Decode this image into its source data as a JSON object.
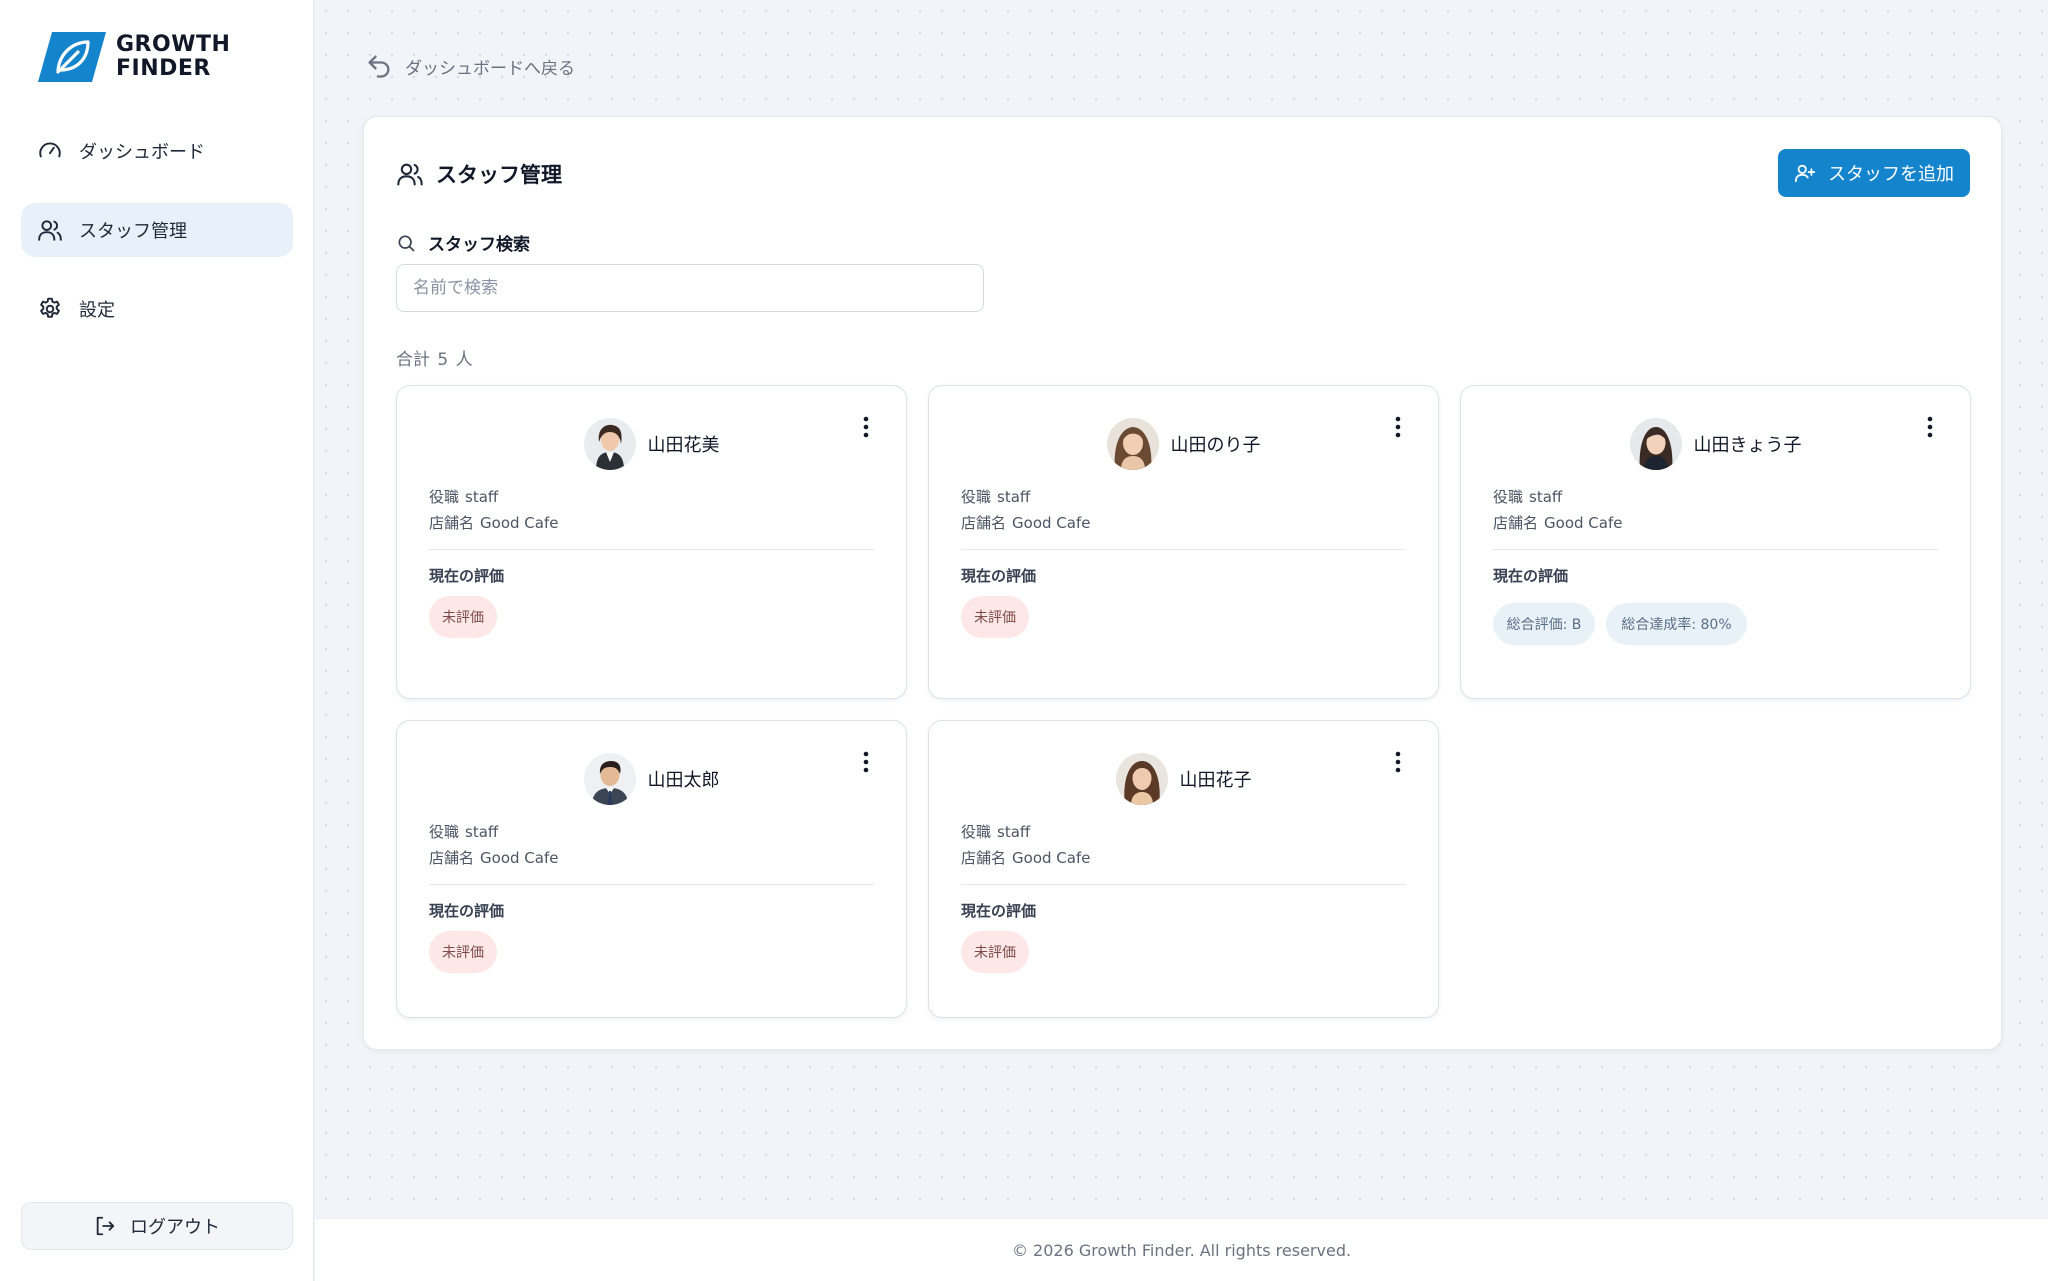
{
  "brand": {
    "line1": "GROWTH",
    "line2": "FINDER",
    "accent": "#1484cc"
  },
  "sidebar": {
    "items": [
      {
        "label": "ダッシュボード",
        "icon": "gauge-icon",
        "active": false
      },
      {
        "label": "スタッフ管理",
        "icon": "users-icon",
        "active": true
      },
      {
        "label": "設定",
        "icon": "gear-icon",
        "active": false
      }
    ],
    "logout": "ログアウト"
  },
  "main": {
    "back_label": "ダッシュボードへ戻る",
    "title": "スタッフ管理",
    "add_button": "スタッフを追加",
    "search_label": "スタッフ検索",
    "search_placeholder": "名前で検索",
    "total": {
      "prefix": "合計",
      "count": "5",
      "suffix": "人"
    }
  },
  "staff": [
    {
      "name": "山田花美",
      "role_label": "役職",
      "role": "staff",
      "store_label": "店舗名",
      "store": "Good Cafe",
      "eval_label": "現在の評価",
      "status": "未評価"
    },
    {
      "name": "山田のり子",
      "role_label": "役職",
      "role": "staff",
      "store_label": "店舗名",
      "store": "Good Cafe",
      "eval_label": "現在の評価",
      "status": "未評価"
    },
    {
      "name": "山田きょう子",
      "role_label": "役職",
      "role": "staff",
      "store_label": "店舗名",
      "store": "Good Cafe",
      "eval_label": "現在の評価",
      "grade": "総合評価: B",
      "rate": "総合達成率: 80%"
    },
    {
      "name": "山田太郎",
      "role_label": "役職",
      "role": "staff",
      "store_label": "店舗名",
      "store": "Good Cafe",
      "eval_label": "現在の評価",
      "status": "未評価"
    },
    {
      "name": "山田花子",
      "role_label": "役職",
      "role": "staff",
      "store_label": "店舗名",
      "store": "Good Cafe",
      "eval_label": "現在の評価",
      "status": "未評価"
    }
  ],
  "footer": "© 2026 Growth Finder. All rights reserved."
}
